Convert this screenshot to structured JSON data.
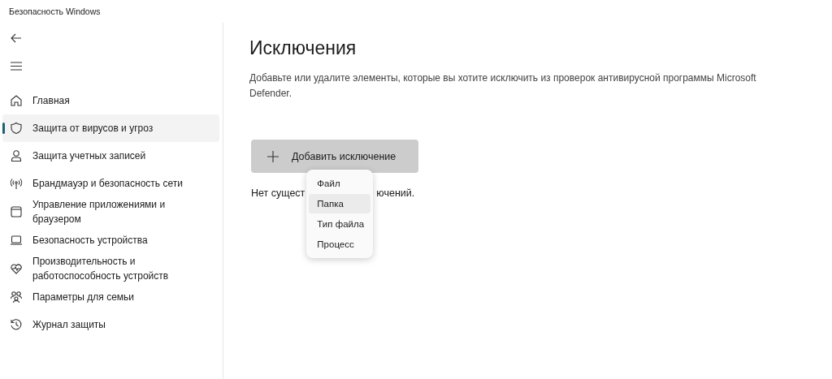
{
  "window": {
    "title": "Безопасность Windows"
  },
  "sidebar": {
    "items": [
      {
        "label": "Главная",
        "kind": "home",
        "selected": false
      },
      {
        "label": "Защита от вирусов и угроз",
        "kind": "shield",
        "selected": true
      },
      {
        "label": "Защита учетных записей",
        "kind": "person",
        "selected": false
      },
      {
        "label": "Брандмауэр и безопасность сети",
        "kind": "antenna",
        "selected": false
      },
      {
        "label": "Управление приложениями и браузером",
        "kind": "window",
        "selected": false
      },
      {
        "label": "Безопасность устройства",
        "kind": "laptop",
        "selected": false
      },
      {
        "label": "Производительность и работоспособность устройств",
        "kind": "heart",
        "selected": false
      },
      {
        "label": "Параметры для семьи",
        "kind": "family",
        "selected": false
      },
      {
        "label": "Журнал защиты",
        "kind": "history",
        "selected": false
      }
    ]
  },
  "main": {
    "heading": "Исключения",
    "description": "Добавьте или удалите элементы, которые вы хотите исключить из проверок антивирусной программы Microsoft Defender.",
    "add_button": "Добавить исключение",
    "empty_text_start": "Нет сущест",
    "empty_text_end": "ючений.",
    "menu": [
      {
        "label": "Файл",
        "selected": false
      },
      {
        "label": "Папка",
        "selected": true
      },
      {
        "label": "Тип файла",
        "selected": false
      },
      {
        "label": "Процесс",
        "selected": false
      }
    ]
  }
}
